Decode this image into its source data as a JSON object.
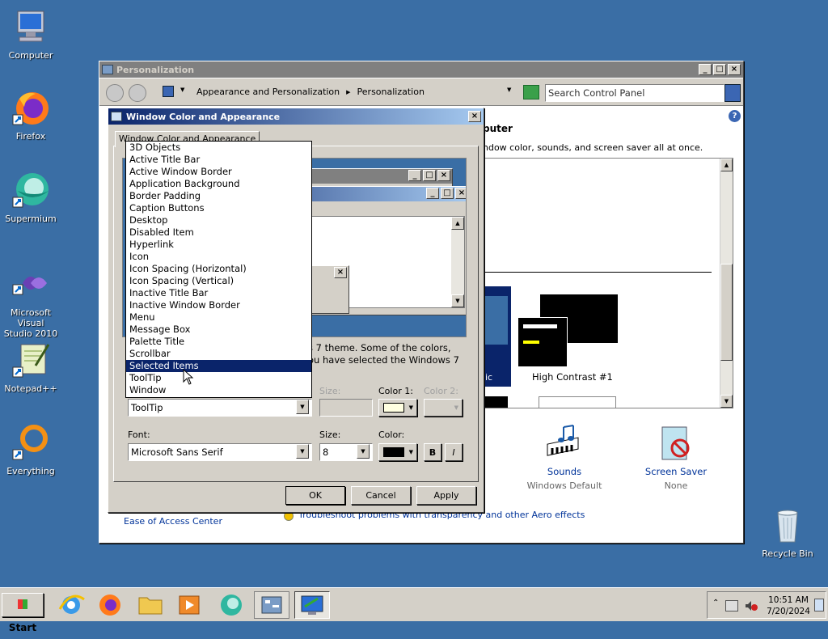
{
  "desktop": {
    "icons": [
      {
        "label": "Computer",
        "icon": "computer-icon"
      },
      {
        "label": "Firefox",
        "icon": "firefox-icon"
      },
      {
        "label": "Supermium",
        "icon": "supermium-icon"
      },
      {
        "label": "Microsoft Visual Studio 2010",
        "icon": "visual-studio-icon"
      },
      {
        "label": "Notepad++",
        "icon": "notepadpp-icon"
      },
      {
        "label": "Everything",
        "icon": "everything-icon"
      },
      {
        "label": "Recycle Bin",
        "icon": "recycle-bin-icon"
      }
    ]
  },
  "personalization": {
    "title": "Personalization",
    "breadcrumb": [
      "Appearance and Personalization",
      "Personalization"
    ],
    "search_placeholder": "Search Control Panel",
    "heading_partial": "puter",
    "subtext_partial": "ndow color, sounds, and screen saver all at once.",
    "theme_label": "High Contrast #1",
    "theme_partial_label": "ic",
    "sounds_label": "Sounds",
    "sounds_value": "Windows Default",
    "screensaver_label": "Screen Saver",
    "screensaver_value": "None",
    "ease_link": "Ease of Access Center",
    "troubleshoot_link": "Troubleshoot problems with transparency and other Aero effects"
  },
  "dialog": {
    "title": "Window Color and Appearance",
    "tab": "Window Color and Appearance",
    "info_line1": "s 7 theme.  Some of the colors,",
    "info_line2": "ou have selected the Windows 7",
    "item_value": "ToolTip",
    "size_label": "Size:",
    "color1_label": "Color 1:",
    "color2_label": "Color 2:",
    "font_label": "Font:",
    "font_value": "Microsoft Sans Serif",
    "font_size_label": "Size:",
    "font_size_value": "8",
    "font_color_label": "Color:",
    "bold_label": "B",
    "italic_label": "I",
    "ok": "OK",
    "cancel": "Cancel",
    "apply": "Apply",
    "colors": {
      "color1": "#ffffe1",
      "font_color": "#000000"
    }
  },
  "item_list": {
    "selected": "Selected Items",
    "items": [
      "3D Objects",
      "Active Title Bar",
      "Active Window Border",
      "Application Background",
      "Border Padding",
      "Caption Buttons",
      "Desktop",
      "Disabled Item",
      "Hyperlink",
      "Icon",
      "Icon Spacing (Horizontal)",
      "Icon Spacing (Vertical)",
      "Inactive Title Bar",
      "Inactive Window Border",
      "Menu",
      "Message Box",
      "Palette Title",
      "Scrollbar",
      "Selected Items",
      "ToolTip",
      "Window"
    ]
  },
  "taskbar": {
    "start": "Start",
    "apps": [
      "internet-explorer-icon",
      "firefox-icon",
      "explorer-folder-icon",
      "media-player-icon",
      "supermium-icon",
      "control-panel-icon",
      "personalization-icon"
    ],
    "time": "10:51 AM",
    "date": "7/20/2024"
  }
}
